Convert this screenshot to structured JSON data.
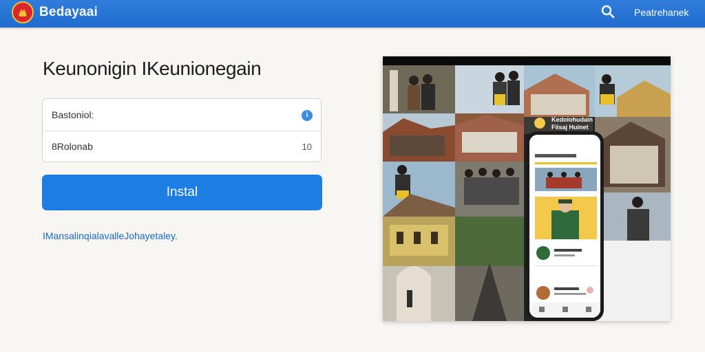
{
  "header": {
    "brand": "Bedayaai",
    "link": "Peatrehanek",
    "icons": [
      "emblem-icon",
      "search-icon"
    ],
    "colors": {
      "bar": "#1f6bcf",
      "logo": "#d8282c",
      "logo_ring": "#f1c232"
    }
  },
  "main": {
    "title": "Keunonigin IKeunionegain",
    "form": {
      "field1_label": "Bastoniol:",
      "field2_label": "8Rolonab",
      "field2_value": "10"
    },
    "install_label": "Instal",
    "footer_link": "IMansalinqialavalleJohayetaley."
  },
  "showcase": {
    "banner_line1": "Kedoiohudain",
    "banner_line2": "Fiisaj Huinet",
    "icons": [
      "photo-collage-icon",
      "phone-icon"
    ],
    "colors": {
      "accent": "#1c7de2",
      "banner": "#f4c84a"
    }
  }
}
